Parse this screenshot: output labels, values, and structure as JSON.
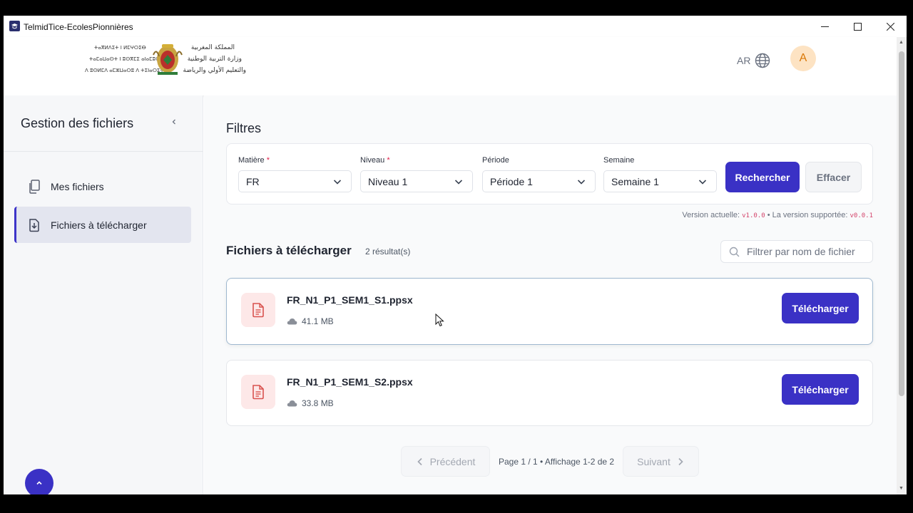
{
  "window": {
    "title": "TelmidTice-EcolesPionnières",
    "controls": {
      "minimize": "—",
      "maximize": "☐",
      "close": "✕"
    }
  },
  "header": {
    "logo_text_lines_ar": [
      "المملكة المغربية",
      "وزارة التربية الوطنية",
      "والتعليم الأولي والرياضة"
    ],
    "logo_text_lines_tifinagh": [
      "ⵜⴰⴳⵍⴷⵉⵜ ⵏ ⵍⵎⵖⵔⵉⴱ",
      "ⵜⴰⵎⴰⵡⴰⵙⵜ ⵏ ⵓⵙⴳⵎⵉ ⴰⵏⴰⵎⵓⵔ",
      "ⴷ ⵓⵙⵍⵎⴷ ⴰⵎⵣⵡⴰⵔⵓ ⴷ ⵜⵉⵏⴰⵔⵉⵜ"
    ],
    "lang_label": "AR",
    "avatar_initial": "A"
  },
  "sidebar": {
    "title": "Gestion des fichiers",
    "items": [
      {
        "label": "Mes fichiers",
        "icon": "files-icon",
        "active": false
      },
      {
        "label": "Fichiers à télécharger",
        "icon": "file-download-icon",
        "active": true
      }
    ]
  },
  "filters": {
    "title": "Filtres",
    "fields": [
      {
        "label": "Matière",
        "required": "*",
        "value": "FR"
      },
      {
        "label": "Niveau",
        "required": "*",
        "value": "Niveau 1"
      },
      {
        "label": "Période",
        "required": "",
        "value": "Période 1"
      },
      {
        "label": "Semaine",
        "required": "",
        "value": "Semaine 1"
      }
    ],
    "search_button": "Rechercher",
    "clear_button": "Effacer"
  },
  "version": {
    "current_label": "Version actuelle:",
    "current_value": "v1.0.0",
    "separator": "•",
    "supported_label": "La version supportée:",
    "supported_value": "v0.0.1"
  },
  "files": {
    "title": "Fichiers à télécharger",
    "results_count": "2 résultat(s)",
    "search_placeholder": "Filtrer par nom de fichier",
    "download_label": "Télécharger",
    "items": [
      {
        "name": "FR_N1_P1_SEM1_S1.ppsx",
        "size": "41.1 MB"
      },
      {
        "name": "FR_N1_P1_SEM1_S2.ppsx",
        "size": "33.8 MB"
      }
    ]
  },
  "pagination": {
    "prev_label": "Précédent",
    "next_label": "Suivant",
    "info": "Page 1 / 1 • Affichage 1-2 de 2"
  },
  "colors": {
    "primary": "#3a31c5",
    "avatar_bg": "#fde3c3",
    "avatar_fg": "#d97706",
    "file_icon_bg": "#fde8e8",
    "file_icon_fg": "#d9534f",
    "required": "#e11d48"
  }
}
